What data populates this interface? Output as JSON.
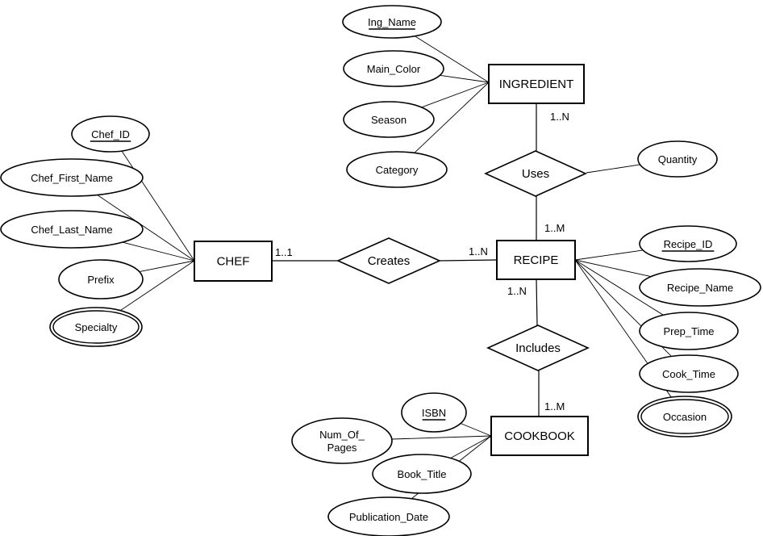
{
  "entities": [
    {
      "id": "ingredient",
      "label": "INGREDIENT"
    },
    {
      "id": "chef",
      "label": "CHEF"
    },
    {
      "id": "recipe",
      "label": "RECIPE"
    },
    {
      "id": "cookbook",
      "label": "COOKBOOK"
    }
  ],
  "relationships": [
    {
      "id": "uses",
      "label": "Uses",
      "between": [
        "ingredient",
        "recipe"
      ],
      "cardinality": [
        "1..N",
        "1..M"
      ]
    },
    {
      "id": "creates",
      "label": "Creates",
      "between": [
        "chef",
        "recipe"
      ],
      "cardinality": [
        "1..1",
        "1..N"
      ]
    },
    {
      "id": "includes",
      "label": "Includes",
      "between": [
        "recipe",
        "cookbook"
      ],
      "cardinality": [
        "1..N",
        "1..M"
      ]
    }
  ],
  "attributes": [
    {
      "id": "ing_name",
      "label": "Ing_Name",
      "owner": "ingredient",
      "key": true
    },
    {
      "id": "main_color",
      "label": "Main_Color",
      "owner": "ingredient"
    },
    {
      "id": "season",
      "label": "Season",
      "owner": "ingredient"
    },
    {
      "id": "category",
      "label": "Category",
      "owner": "ingredient"
    },
    {
      "id": "quantity",
      "label": "Quantity",
      "owner": "uses"
    },
    {
      "id": "chef_id",
      "label": "Chef_ID",
      "owner": "chef",
      "key": true
    },
    {
      "id": "chef_first_name",
      "label": "Chef_First_Name",
      "owner": "chef"
    },
    {
      "id": "chef_last_name",
      "label": "Chef_Last_Name",
      "owner": "chef"
    },
    {
      "id": "prefix",
      "label": "Prefix",
      "owner": "chef"
    },
    {
      "id": "specialty",
      "label": "Specialty",
      "owner": "chef",
      "multivalued": true
    },
    {
      "id": "recipe_id",
      "label": "Recipe_ID",
      "owner": "recipe",
      "key": true
    },
    {
      "id": "recipe_name",
      "label": "Recipe_Name",
      "owner": "recipe"
    },
    {
      "id": "prep_time",
      "label": "Prep_Time",
      "owner": "recipe"
    },
    {
      "id": "cook_time",
      "label": "Cook_Time",
      "owner": "recipe"
    },
    {
      "id": "occasion",
      "label": "Occasion",
      "owner": "recipe",
      "multivalued": true
    },
    {
      "id": "isbn",
      "label": "ISBN",
      "owner": "cookbook",
      "key": true
    },
    {
      "id": "num_of_pages",
      "label": "Num_Of_\nPages",
      "owner": "cookbook"
    },
    {
      "id": "book_title",
      "label": "Book_Title",
      "owner": "cookbook"
    },
    {
      "id": "publication_date",
      "label": "Publication_Date",
      "owner": "cookbook"
    }
  ]
}
